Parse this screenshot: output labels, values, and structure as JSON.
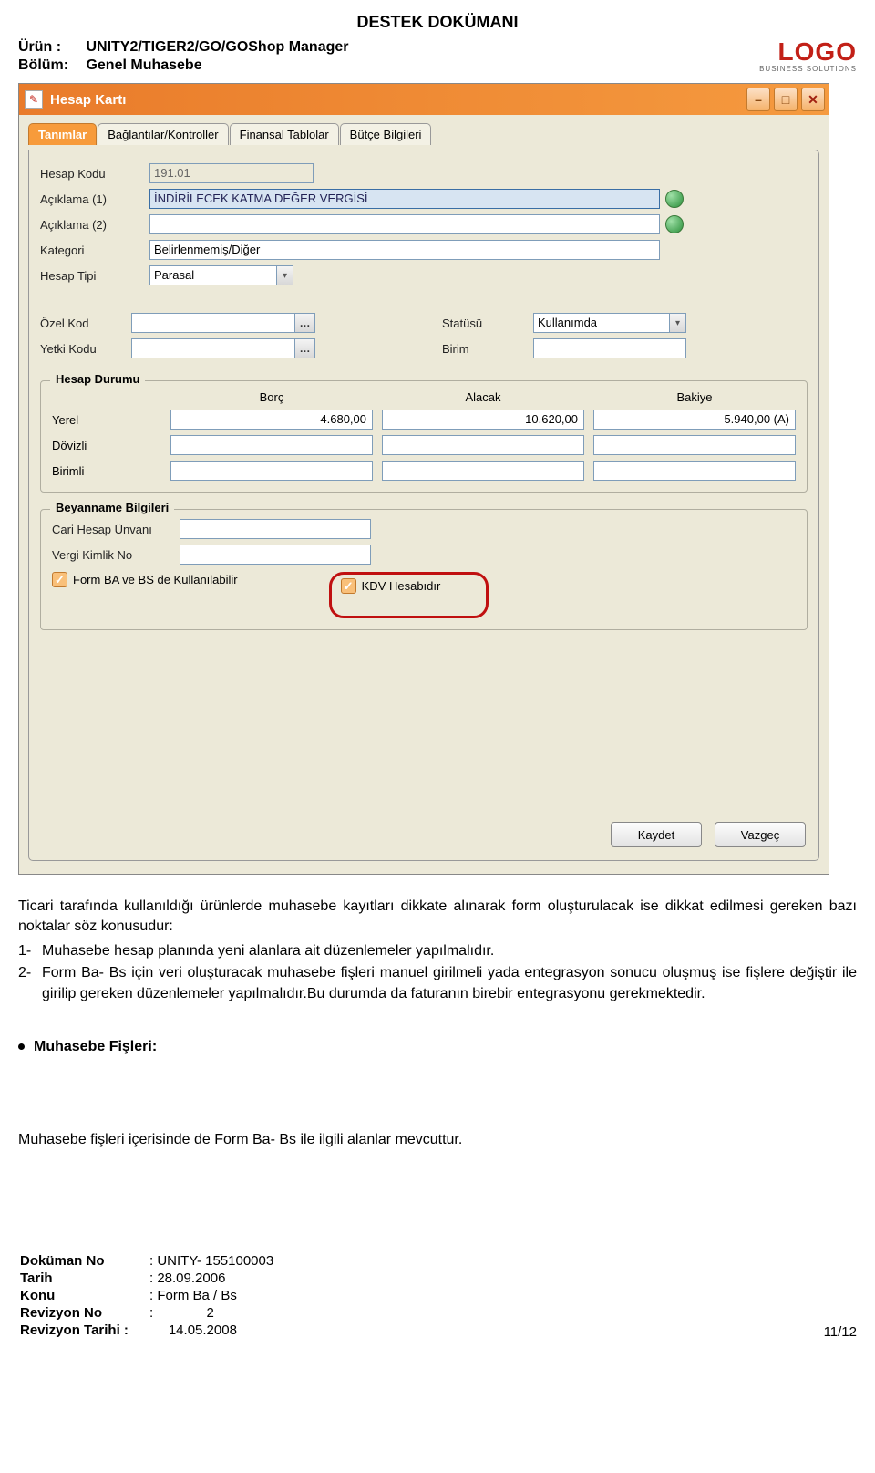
{
  "doc": {
    "title": "DESTEK DOKÜMANI",
    "product_label": "Ürün  :",
    "product_value": "UNITY2/TIGER2/GO/GOShop Manager",
    "section_label": "Bölüm:",
    "section_value": "Genel Muhasebe",
    "logo_main": "LOGO",
    "logo_sub": "BUSINESS SOLUTIONS"
  },
  "window": {
    "title": "Hesap Kartı",
    "tabs": [
      "Tanımlar",
      "Bağlantılar/Kontroller",
      "Finansal Tablolar",
      "Bütçe Bilgileri"
    ],
    "fields": {
      "hesap_kodu_label": "Hesap Kodu",
      "hesap_kodu_value": "191.01",
      "aciklama1_label": "Açıklama (1)",
      "aciklama1_value": "İNDİRİLECEK KATMA DEĞER VERGİSİ",
      "aciklama2_label": "Açıklama (2)",
      "aciklama2_value": "",
      "kategori_label": "Kategori",
      "kategori_value": "Belirlenmemiş/Diğer",
      "hesap_tipi_label": "Hesap Tipi",
      "hesap_tipi_value": "Parasal",
      "ozel_kod_label": "Özel Kod",
      "ozel_kod_value": "",
      "yetki_kodu_label": "Yetki Kodu",
      "yetki_kodu_value": "",
      "statusu_label": "Statüsü",
      "statusu_value": "Kullanımda",
      "birim_label": "Birim",
      "birim_value": ""
    },
    "hesap_durumu": {
      "legend": "Hesap Durumu",
      "headers": [
        "Borç",
        "Alacak",
        "Bakiye"
      ],
      "rows": [
        {
          "label": "Yerel",
          "borc": "4.680,00",
          "alacak": "10.620,00",
          "bakiye": "5.940,00 (A)"
        },
        {
          "label": "Dövizli",
          "borc": "",
          "alacak": "",
          "bakiye": ""
        },
        {
          "label": "Birimli",
          "borc": "",
          "alacak": "",
          "bakiye": ""
        }
      ]
    },
    "beyanname": {
      "legend": "Beyanname Bilgileri",
      "cari_label": "Cari Hesap Ünvanı",
      "cari_value": "",
      "vergi_label": "Vergi Kimlik No",
      "vergi_value": "",
      "chk1": "Form BA ve BS de Kullanılabilir",
      "chk2": "KDV Hesabıdır"
    },
    "buttons": {
      "save": "Kaydet",
      "cancel": "Vazgeç"
    }
  },
  "body": {
    "intro": "Ticari tarafında kullanıldığı ürünlerde muhasebe kayıtları dikkate alınarak form oluşturulacak ise dikkat edilmesi gereken bazı noktalar söz konusudur:",
    "item1_num": "1-",
    "item1": "Muhasebe hesap planında yeni alanlara ait düzenlemeler yapılmalıdır.",
    "item2_num": "2-",
    "item2": "Form Ba- Bs için veri oluşturacak muhasebe fişleri manuel girilmeli yada entegrasyon sonucu oluşmuş ise fişlere değiştir ile girilip gereken düzenlemeler yapılmalıdır.Bu durumda da faturanın birebir entegrasyonu gerekmektedir.",
    "heading": "Muhasebe Fişleri:",
    "plain": "Muhasebe fişleri içerisinde de Form Ba- Bs ile ilgili alanlar mevcuttur."
  },
  "footer": {
    "dokuman_no_k": "Doküman No",
    "dokuman_no_v": ": UNITY- 155100003",
    "tarih_k": "Tarih",
    "tarih_v": ": 28.09.2006",
    "konu_k": "Konu",
    "konu_v": ": Form Ba / Bs",
    "rev_no_k": "Revizyon No",
    "rev_no_v": ":              2",
    "rev_tarih_k": "Revizyon Tarihi :",
    "rev_tarih_v": "     14.05.2008",
    "page": "11/12"
  }
}
